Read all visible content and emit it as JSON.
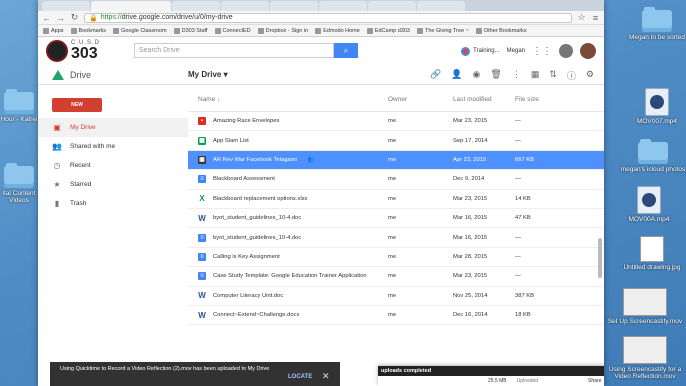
{
  "desktop": {
    "icons": [
      {
        "label": "Megan to be sorted",
        "type": "folder"
      },
      {
        "label": "MOV007.mp4",
        "type": "movie"
      },
      {
        "label": "megan's icloud photos",
        "type": "folder"
      },
      {
        "label": "MOV00A.mp4",
        "type": "movie"
      },
      {
        "label": "Untitled drawing.jpg",
        "type": "image"
      },
      {
        "label": "Set Up Screencastify.mov",
        "type": "thumb"
      },
      {
        "label": "Using Screencastify for a Video Reflection.mov",
        "type": "thumb"
      },
      {
        "label": "Hour - Katrei",
        "type": "folder"
      },
      {
        "label": "ital Content Videos",
        "type": "folder"
      }
    ]
  },
  "browser": {
    "tabs": [
      "",
      "",
      "",
      "",
      "",
      "",
      "",
      ""
    ],
    "url_scheme": "https://",
    "url_rest": "drive.google.com/drive/u/0/my-drive",
    "bookmarks": [
      "Apps",
      "Bookmarks",
      "Google Classroom",
      "D303 Staff",
      "ConnectED",
      "Dropbox - Sign in",
      "Edmodo Home",
      "EdCamp d303",
      "The Giving Tree ~",
      "Other Bookmarks"
    ]
  },
  "header": {
    "district_top": "C.U.S.D",
    "district_num": "303",
    "search_placeholder": "Search Drive",
    "training_label": "Training...",
    "user_name": "Megan"
  },
  "drivebar": {
    "app_name": "Drive",
    "location": "My Drive"
  },
  "sidebar": {
    "new_label": "NEW",
    "items": [
      {
        "label": "My Drive",
        "icon": "drive-icon"
      },
      {
        "label": "Shared with me",
        "icon": "people-icon"
      },
      {
        "label": "Recent",
        "icon": "clock-icon"
      },
      {
        "label": "Starred",
        "icon": "star-icon"
      },
      {
        "label": "Trash",
        "icon": "trash-icon"
      }
    ]
  },
  "table": {
    "headers": {
      "name": "Name",
      "owner": "Owner",
      "modified": "Last modified",
      "size": "File size"
    },
    "rows": [
      {
        "name": "Amazing Race Envelopes",
        "owner": "me",
        "modified": "Mar 23, 2015",
        "size": "—",
        "kind": "slides",
        "color": "#d93025"
      },
      {
        "name": "App Slam List",
        "owner": "me",
        "modified": "Sep 17, 2014",
        "size": "—",
        "kind": "sheet",
        "color": "#0f9d58"
      },
      {
        "name": "AR Rev War Facebook Telagami",
        "owner": "me",
        "modified": "Apr 23, 2015",
        "size": "667 KB",
        "kind": "image",
        "color": "#333"
      },
      {
        "name": "Blackboard Assessment",
        "owner": "me",
        "modified": "Dec 9, 2014",
        "size": "—",
        "kind": "doc",
        "color": "#4285f4"
      },
      {
        "name": "Blackboard replacement options.xlsx",
        "owner": "me",
        "modified": "Mar 23, 2015",
        "size": "14 KB",
        "kind": "excel",
        "color": "#0f9d58"
      },
      {
        "name": "byot_student_guidelines_10-4.doc",
        "owner": "me",
        "modified": "Mar 16, 2015",
        "size": "47 KB",
        "kind": "word",
        "color": "#2a5699"
      },
      {
        "name": "byot_student_guidelines_10-4.doc",
        "owner": "me",
        "modified": "Mar 16, 2015",
        "size": "—",
        "kind": "doc",
        "color": "#4285f4"
      },
      {
        "name": "Calling is Key Assignment",
        "owner": "me",
        "modified": "Mar 28, 2015",
        "size": "—",
        "kind": "doc",
        "color": "#4285f4"
      },
      {
        "name": "Case Study Template: Google Education Trainer Application",
        "owner": "me",
        "modified": "Mar 23, 2015",
        "size": "—",
        "kind": "doc",
        "color": "#4285f4"
      },
      {
        "name": "Computer Literacy Unit.doc",
        "owner": "me",
        "modified": "Nov 25, 2014",
        "size": "387 KB",
        "kind": "word",
        "color": "#2a5699"
      },
      {
        "name": "Connect~Extend~Challenge.docx",
        "owner": "me",
        "modified": "Dec 16, 2014",
        "size": "18 KB",
        "kind": "word",
        "color": "#2a5699"
      }
    ]
  },
  "toast": {
    "message": "Using Quicktime to Record a Video Reflection (2).mov has been uploaded to My Drive",
    "action": "LOCATE"
  },
  "upload_panel": {
    "title": "uploads completed",
    "row_size": "25.5 MB",
    "row_status": "Uploaded",
    "row_action": "Share"
  }
}
